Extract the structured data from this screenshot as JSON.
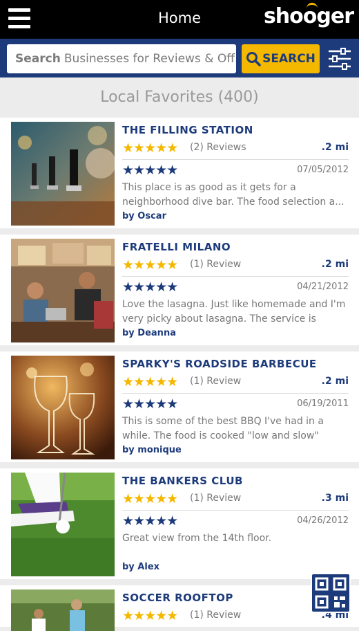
{
  "header": {
    "title": "Home",
    "logo_text": "shooger"
  },
  "search": {
    "placeholder_bold": "Search",
    "placeholder_rest": "Businesses for Reviews & Off...",
    "button_label": "SEARCH"
  },
  "section": {
    "title": "Local Favorites (400)"
  },
  "colors": {
    "brand_navy": "#1d3b7b",
    "accent_gold": "#f5b800"
  },
  "listings": [
    {
      "name": "THE FILLING STATION",
      "stars": "★★★★★",
      "review_count": "(2) Reviews",
      "distance": ".2 mi",
      "review_stars": "★★★★★",
      "review_date": "07/05/2012",
      "review_text": "This place is as good as it gets for a neighborhood dive bar. The food selection a...",
      "author": "by Oscar",
      "photo_icon": "beer-taps-photo"
    },
    {
      "name": "FRATELLI MILANO",
      "stars": "★★★★★",
      "review_count": "(1) Review",
      "distance": ".2 mi",
      "review_stars": "★★★★★",
      "review_date": "04/21/2012",
      "review_text": "Love the lasagna. Just like homemade and I'm very picky about lasagna. The service is excell...",
      "author": "by Deanna",
      "photo_icon": "cafe-people-photo"
    },
    {
      "name": "SPARKY'S ROADSIDE BARBECUE",
      "stars": "★★★★★",
      "review_count": "(1) Review",
      "distance": ".2 mi",
      "review_stars": "★★★★★",
      "review_date": "06/19/2011",
      "review_text": "This is some of the best BBQ I've had in a while. The food is cooked \"low and slow\" and...",
      "author": "by monique",
      "photo_icon": "wine-glasses-photo"
    },
    {
      "name": "THE BANKERS CLUB",
      "stars": "★★★★★",
      "review_count": "(1) Review",
      "distance": ".3 mi",
      "review_stars": "★★★★★",
      "review_date": "04/26/2012",
      "review_text": "Great view from the 14th floor.",
      "author": "by Alex",
      "photo_icon": "golf-photo"
    },
    {
      "name": "SOCCER ROOFTOP",
      "stars": "★★★★★",
      "review_count": "(1) Review",
      "distance": ".4 mi",
      "photo_icon": "soccer-photo"
    }
  ]
}
